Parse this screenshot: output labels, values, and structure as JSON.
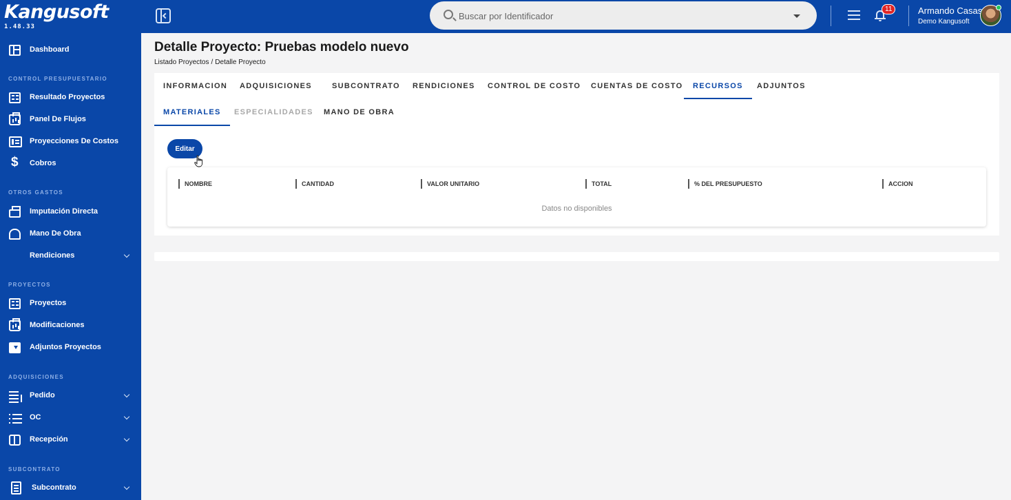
{
  "app": {
    "logo": "Kangusoft",
    "version": "1.48.33"
  },
  "search": {
    "placeholder": "Buscar por Identificador"
  },
  "notifications": {
    "count": "11"
  },
  "user": {
    "name": "Armando Casas",
    "company": "Demo Kangusoft"
  },
  "sidebar": {
    "dashboard": "Dashboard",
    "sections": {
      "control": "CONTROL PRESUPUESTARIO",
      "otros": "OTROS GASTOS",
      "proyectos": "PROYECTOS",
      "adquisiciones": "ADQUISICIONES",
      "subcontrato": "SUBCONTRATO"
    },
    "items": {
      "resultado_proyectos": "Resultado Proyectos",
      "panel_flujos": "Panel De Flujos",
      "proyecciones_costos": "Proyecciones De Costos",
      "cobros": "Cobros",
      "imputacion_directa": "Imputación Directa",
      "mano_obra": "Mano De Obra",
      "rendiciones": "Rendiciones",
      "proyectos": "Proyectos",
      "modificaciones": "Modificaciones",
      "adjuntos_proyectos": "Adjuntos Proyectos",
      "pedido": "Pedido",
      "oc": "OC",
      "recepcion": "Recepción",
      "subcontrato": "Subcontrato"
    }
  },
  "page": {
    "title": "Detalle Proyecto: Pruebas modelo nuevo",
    "breadcrumb": [
      "Listado Proyectos",
      "Detalle Proyecto"
    ],
    "breadcrumb_separator": "/"
  },
  "tabs": {
    "informacion": "INFORMACION",
    "adquisiciones": "ADQUISICIONES",
    "subcontrato": "SUBCONTRATO",
    "rendiciones": "RENDICIONES",
    "control_costo": "CONTROL DE COSTO",
    "cuentas_costo": "CUENTAS DE COSTO",
    "recursos": "RECURSOS",
    "adjuntos": "ADJUNTOS"
  },
  "subtabs": {
    "materiales": "MATERIALES",
    "especialidades": "ESPECIALIDADES",
    "mano_obra": "MANO DE OBRA"
  },
  "actions": {
    "edit": "Editar"
  },
  "table": {
    "columns": [
      "NOMBRE",
      "CANTIDAD",
      "VALOR UNITARIO",
      "TOTAL",
      "% DEL PRESUPUESTO",
      "ACCION"
    ],
    "empty": "Datos no disponibles"
  },
  "colors": {
    "primary": "#0a47a8",
    "badge": "#e02424",
    "online": "#22c55e"
  }
}
